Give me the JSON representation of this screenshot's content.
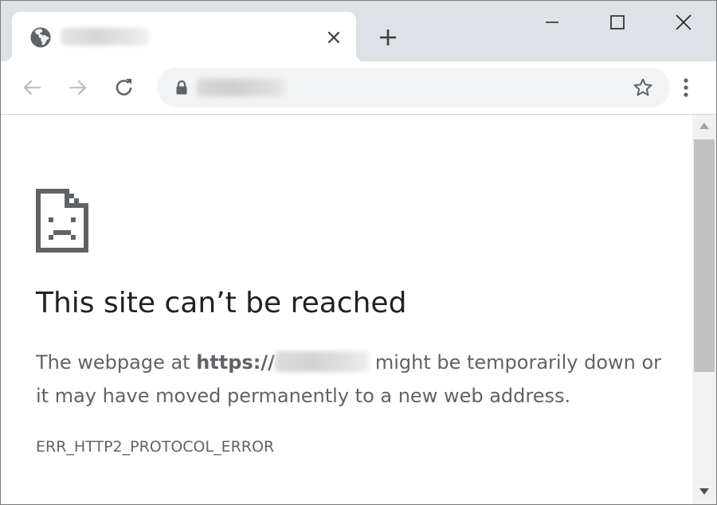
{
  "tab": {
    "title": "localhost",
    "favicon": "globe-icon",
    "close_icon": "close-icon"
  },
  "tabstrip": {
    "new_tab_icon": "plus-icon"
  },
  "window_controls": {
    "minimize_icon": "minimize-icon",
    "maximize_icon": "maximize-icon",
    "close_icon": "close-icon"
  },
  "toolbar": {
    "back_icon": "back-arrow-icon",
    "forward_icon": "forward-arrow-icon",
    "reload_icon": "reload-icon",
    "menu_icon": "kebab-menu-icon"
  },
  "omnibox": {
    "lock_icon": "lock-icon",
    "url": "localhost",
    "bookmark_icon": "star-icon"
  },
  "error": {
    "icon": "sad-page-icon",
    "title": "This site can’t be reached",
    "desc_prefix": "The webpage at ",
    "desc_scheme": "https://",
    "desc_host": "localhost",
    "desc_suffix": "might be temporarily down or it may have moved permanently to a new web address.",
    "code": "ERR_HTTP2_PROTOCOL_ERROR"
  },
  "colors": {
    "tabstrip_bg": "#dee1e6",
    "omnibox_bg": "#f1f3f4",
    "title_text": "#202124",
    "body_text": "#5f6368",
    "scroll_thumb": "#c1c1c1"
  }
}
